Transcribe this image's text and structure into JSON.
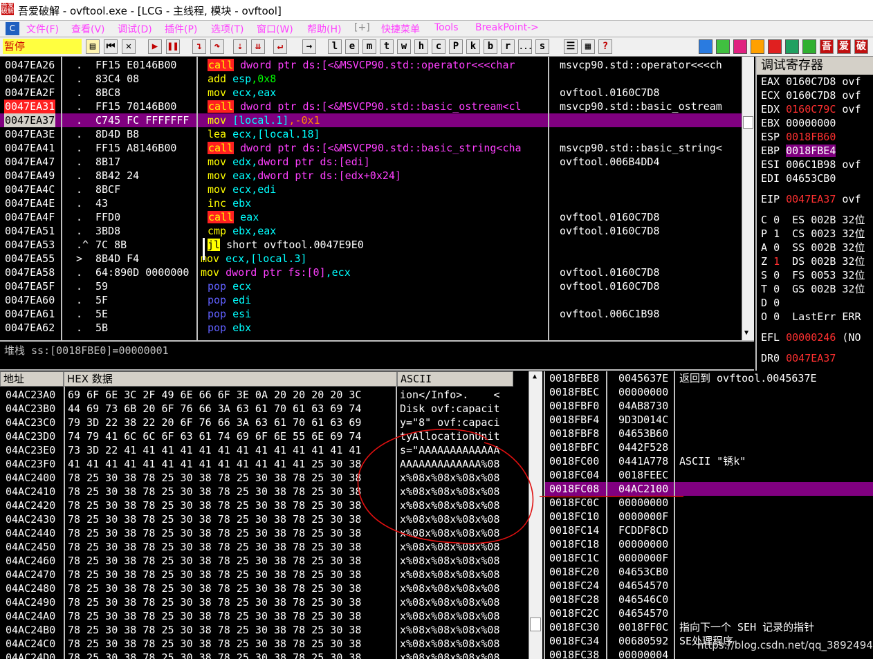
{
  "window": {
    "title": "吾爱破解 - ovftool.exe - [LCG - 主线程, 模块 - ovftool]"
  },
  "menu": [
    "文件(F)",
    "查看(V)",
    "调试(D)",
    "插件(P)",
    "选项(T)",
    "窗口(W)",
    "帮助(H)",
    "[+]",
    "快捷菜单",
    "Tools",
    "BreakPoint->"
  ],
  "toolbar": {
    "status": "暂停",
    "letters": [
      "l",
      "e",
      "m",
      "t",
      "w",
      "h",
      "c",
      "P",
      "k",
      "b",
      "r",
      "...",
      "s"
    ],
    "right_icons": [
      "吾",
      "爱",
      "破"
    ]
  },
  "disasm": {
    "rows": [
      {
        "addr": "0047EA26",
        "mark": ".",
        "hex": "FF15 E0146B00",
        "instr": [
          [
            "call",
            "callbox"
          ],
          [
            " dword ptr ds:[<&MSVCP90.std::operator<<<char",
            "m"
          ]
        ],
        "cmt": "msvcp90.std::operator<<<ch"
      },
      {
        "addr": "0047EA2C",
        "mark": ".",
        "hex": "83C4 08",
        "instr": [
          [
            "add ",
            "y"
          ],
          [
            "esp",
            "c"
          ],
          [
            ",0x8",
            "g"
          ]
        ],
        "cmt": ""
      },
      {
        "addr": "0047EA2F",
        "mark": ".",
        "hex": "8BC8",
        "instr": [
          [
            "mov ",
            "y"
          ],
          [
            "ecx,eax",
            "c"
          ]
        ],
        "cmt": "ovftool.0160C7D8"
      },
      {
        "addr": "0047EA31",
        "mark": ".",
        "hex": "FF15 70146B00",
        "instr": [
          [
            "call",
            "callbox"
          ],
          [
            " dword ptr ds:[<&MSVCP90.std::basic_ostream<cl",
            "m"
          ]
        ],
        "cmt": "msvcp90.std::basic_ostream",
        "addrHi": "red"
      },
      {
        "addr": "0047EA37",
        "mark": ".",
        "hex": "C745 FC FFFFFFF",
        "instr": [
          [
            "mov ",
            "y"
          ],
          [
            "[local.1]",
            "c"
          ],
          [
            ",-0x1",
            "o"
          ]
        ],
        "cmt": "",
        "sel": true
      },
      {
        "addr": "0047EA3E",
        "mark": ".",
        "hex": "8D4D B8",
        "instr": [
          [
            "lea ",
            "y"
          ],
          [
            "ecx,[local.18]",
            "c"
          ]
        ],
        "cmt": ""
      },
      {
        "addr": "0047EA41",
        "mark": ".",
        "hex": "FF15 A8146B00",
        "instr": [
          [
            "call",
            "callbox"
          ],
          [
            " dword ptr ds:[<&MSVCP90.std::basic_string<cha",
            "m"
          ]
        ],
        "cmt": "msvcp90.std::basic_string<"
      },
      {
        "addr": "0047EA47",
        "mark": ".",
        "hex": "8B17",
        "instr": [
          [
            "mov ",
            "y"
          ],
          [
            "edx,",
            "c"
          ],
          [
            "dword ptr ds:[edi]",
            "m"
          ]
        ],
        "cmt": "ovftool.006B4DD4"
      },
      {
        "addr": "0047EA49",
        "mark": ".",
        "hex": "8B42 24",
        "instr": [
          [
            "mov ",
            "y"
          ],
          [
            "eax,",
            "c"
          ],
          [
            "dword ptr ds:[edx+0x24]",
            "m"
          ]
        ],
        "cmt": ""
      },
      {
        "addr": "0047EA4C",
        "mark": ".",
        "hex": "8BCF",
        "instr": [
          [
            "mov ",
            "y"
          ],
          [
            "ecx,edi",
            "c"
          ]
        ],
        "cmt": ""
      },
      {
        "addr": "0047EA4E",
        "mark": ".",
        "hex": "43",
        "instr": [
          [
            "inc ",
            "y"
          ],
          [
            "ebx",
            "c"
          ]
        ],
        "cmt": ""
      },
      {
        "addr": "0047EA4F",
        "mark": ".",
        "hex": "FFD0",
        "instr": [
          [
            "call",
            "callbox"
          ],
          [
            " eax",
            "c"
          ]
        ],
        "cmt": "ovftool.0160C7D8"
      },
      {
        "addr": "0047EA51",
        "mark": ".",
        "hex": "3BD8",
        "instr": [
          [
            "cmp ",
            "y"
          ],
          [
            "ebx,eax",
            "c"
          ]
        ],
        "cmt": "ovftool.0160C7D8"
      },
      {
        "addr": "0047EA53",
        "mark": ".^",
        "hex": "7C 8B",
        "instr": [
          [
            "jl",
            "jl"
          ],
          [
            " short ovftool.0047E9E0",
            "w"
          ]
        ],
        "cmt": ""
      },
      {
        "addr": "0047EA55",
        "mark": ">",
        "hex": "8B4D F4",
        "instr": [
          [
            "mov ",
            "y"
          ],
          [
            "ecx,[local.3]",
            "c"
          ]
        ],
        "cmt": "",
        "noBar": true
      },
      {
        "addr": "0047EA58",
        "mark": ".",
        "hex": "64:890D 0000000",
        "instr": [
          [
            "mov ",
            "y"
          ],
          [
            "dword ptr fs:[0]",
            "m"
          ],
          [
            ",ecx",
            "c"
          ]
        ],
        "cmt": "ovftool.0160C7D8",
        "noBar": true
      },
      {
        "addr": "0047EA5F",
        "mark": ".",
        "hex": "59",
        "instr": [
          [
            "pop ",
            "bl"
          ],
          [
            "ecx",
            "c"
          ]
        ],
        "cmt": "ovftool.0160C7D8"
      },
      {
        "addr": "0047EA60",
        "mark": ".",
        "hex": "5F",
        "instr": [
          [
            "pop ",
            "bl"
          ],
          [
            "edi",
            "c"
          ]
        ],
        "cmt": ""
      },
      {
        "addr": "0047EA61",
        "mark": ".",
        "hex": "5E",
        "instr": [
          [
            "pop ",
            "bl"
          ],
          [
            "esi",
            "c"
          ]
        ],
        "cmt": "ovftool.006C1B98"
      },
      {
        "addr": "0047EA62",
        "mark": ".",
        "hex": "5B",
        "instr": [
          [
            "pop ",
            "bl"
          ],
          [
            "ebx",
            "c"
          ]
        ],
        "cmt": ""
      }
    ],
    "info_line": "堆栈 ss:[0018FBE0]=00000001"
  },
  "registers": {
    "header": "调试寄存器",
    "gp": [
      {
        "name": "EAX",
        "val": "0160C7D8",
        "cmt": "ovf"
      },
      {
        "name": "ECX",
        "val": "0160C7D8",
        "cmt": "ovf"
      },
      {
        "name": "EDX",
        "val": "0160C79C",
        "cmt": "ovf",
        "red": true
      },
      {
        "name": "EBX",
        "val": "00000000",
        "cmt": ""
      },
      {
        "name": "ESP",
        "val": "0018FB60",
        "cmt": "",
        "red": true
      },
      {
        "name": "EBP",
        "val": "0018FBE4",
        "cmt": "",
        "hi": true
      },
      {
        "name": "ESI",
        "val": "006C1B98",
        "cmt": "ovf"
      },
      {
        "name": "EDI",
        "val": "04653CB0",
        "cmt": ""
      }
    ],
    "eip": {
      "name": "EIP",
      "val": "0047EA37",
      "cmt": "ovf"
    },
    "flags": [
      {
        "f": "C",
        "v": "0",
        "seg": "ES",
        "sv": "002B",
        "bits": "32位"
      },
      {
        "f": "P",
        "v": "1",
        "seg": "CS",
        "sv": "0023",
        "bits": "32位"
      },
      {
        "f": "A",
        "v": "0",
        "seg": "SS",
        "sv": "002B",
        "bits": "32位"
      },
      {
        "f": "Z",
        "v": "1",
        "seg": "DS",
        "sv": "002B",
        "bits": "32位",
        "red": true
      },
      {
        "f": "S",
        "v": "0",
        "seg": "FS",
        "sv": "0053",
        "bits": "32位"
      },
      {
        "f": "T",
        "v": "0",
        "seg": "GS",
        "sv": "002B",
        "bits": "32位"
      },
      {
        "f": "D",
        "v": "0",
        "seg": "",
        "sv": "",
        "bits": ""
      },
      {
        "f": "O",
        "v": "0",
        "seg": "LastErr",
        "sv": "ERR",
        "bits": ""
      }
    ],
    "efl": {
      "name": "EFL",
      "val": "00000246",
      "cmt": "(NO"
    },
    "dr0": {
      "name": "DR0",
      "val": "0047EA37"
    }
  },
  "dump": {
    "headers": {
      "addr": "地址",
      "hex": "HEX 数据",
      "ascii": "ASCII"
    },
    "rows": [
      {
        "addr": "04AC23A0",
        "hex": "69 6F 6E 3C|2F 49 6E 66|6F 3E 0A 20|20 20 20 3C",
        "ascii": "ion</Info>.    <"
      },
      {
        "addr": "04AC23B0",
        "hex": "44 69 73 6B|20 6F 76 66|3A 63 61 70|61 63 69 74",
        "ascii": "Disk ovf:capacit"
      },
      {
        "addr": "04AC23C0",
        "hex": "79 3D 22 38|22 20 6F 76|66 3A 63 61|70 61 63 69",
        "ascii": "y=\"8\" ovf:capaci"
      },
      {
        "addr": "04AC23D0",
        "hex": "74 79 41 6C|6C 6F 63 61|74 69 6F 6E|55 6E 69 74",
        "ascii": "tyAllocationUnit"
      },
      {
        "addr": "04AC23E0",
        "hex": "73 3D 22 41|41 41 41 41|41 41 41 41|41 41 41 41",
        "ascii": "s=\"AAAAAAAAAAAAA"
      },
      {
        "addr": "04AC23F0",
        "hex": "41 41 41 41|41 41 41 41|41 41 41 41|41 25 30 38",
        "ascii": "AAAAAAAAAAAAA%08"
      },
      {
        "addr": "04AC2400",
        "hex": "78 25 30 38|78 25 30 38|78 25 30 38|78 25 30 38",
        "ascii": "x%08x%08x%08x%08"
      },
      {
        "addr": "04AC2410",
        "hex": "78 25 30 38|78 25 30 38|78 25 30 38|78 25 30 38",
        "ascii": "x%08x%08x%08x%08"
      },
      {
        "addr": "04AC2420",
        "hex": "78 25 30 38|78 25 30 38|78 25 30 38|78 25 30 38",
        "ascii": "x%08x%08x%08x%08"
      },
      {
        "addr": "04AC2430",
        "hex": "78 25 30 38|78 25 30 38|78 25 30 38|78 25 30 38",
        "ascii": "x%08x%08x%08x%08"
      },
      {
        "addr": "04AC2440",
        "hex": "78 25 30 38|78 25 30 38|78 25 30 38|78 25 30 38",
        "ascii": "x%08x%08x%08x%08"
      },
      {
        "addr": "04AC2450",
        "hex": "78 25 30 38|78 25 30 38|78 25 30 38|78 25 30 38",
        "ascii": "x%08x%08x%08x%08"
      },
      {
        "addr": "04AC2460",
        "hex": "78 25 30 38|78 25 30 38|78 25 30 38|78 25 30 38",
        "ascii": "x%08x%08x%08x%08"
      },
      {
        "addr": "04AC2470",
        "hex": "78 25 30 38|78 25 30 38|78 25 30 38|78 25 30 38",
        "ascii": "x%08x%08x%08x%08"
      },
      {
        "addr": "04AC2480",
        "hex": "78 25 30 38|78 25 30 38|78 25 30 38|78 25 30 38",
        "ascii": "x%08x%08x%08x%08"
      },
      {
        "addr": "04AC2490",
        "hex": "78 25 30 38|78 25 30 38|78 25 30 38|78 25 30 38",
        "ascii": "x%08x%08x%08x%08"
      },
      {
        "addr": "04AC24A0",
        "hex": "78 25 30 38|78 25 30 38|78 25 30 38|78 25 30 38",
        "ascii": "x%08x%08x%08x%08"
      },
      {
        "addr": "04AC24B0",
        "hex": "78 25 30 38|78 25 30 38|78 25 30 38|78 25 30 38",
        "ascii": "x%08x%08x%08x%08"
      },
      {
        "addr": "04AC24C0",
        "hex": "78 25 30 38|78 25 30 38|78 25 30 38|78 25 30 38",
        "ascii": "x%08x%08x%08x%08"
      },
      {
        "addr": "04AC24D0",
        "hex": "78 25 30 38|78 25 30 38|78 25 30 38|78 25 30 38",
        "ascii": "x%08x%08x%08x%08"
      }
    ]
  },
  "stack": {
    "rows": [
      {
        "addr": "0018FBE8",
        "val": "0045637E",
        "cmt": "返回到 ovftool.0045637E"
      },
      {
        "addr": "0018FBEC",
        "val": "00000000",
        "cmt": ""
      },
      {
        "addr": "0018FBF0",
        "val": "04AB8730",
        "cmt": ""
      },
      {
        "addr": "0018FBF4",
        "val": "9D3D014C",
        "cmt": ""
      },
      {
        "addr": "0018FBF8",
        "val": "04653B60",
        "cmt": ""
      },
      {
        "addr": "0018FBFC",
        "val": "0442F528",
        "cmt": ""
      },
      {
        "addr": "0018FC00",
        "val": "0441A778",
        "cmt": "ASCII \"锈k\""
      },
      {
        "addr": "0018FC04",
        "val": "0018FEEC",
        "cmt": ""
      },
      {
        "addr": "0018FC08",
        "val": "04AC2100",
        "cmt": "",
        "sel": true
      },
      {
        "addr": "0018FC0C",
        "val": "00000000",
        "cmt": ""
      },
      {
        "addr": "0018FC10",
        "val": "0000000F",
        "cmt": ""
      },
      {
        "addr": "0018FC14",
        "val": "FCDDF8CD",
        "cmt": ""
      },
      {
        "addr": "0018FC18",
        "val": "00000000",
        "cmt": ""
      },
      {
        "addr": "0018FC1C",
        "val": "0000000F",
        "cmt": ""
      },
      {
        "addr": "0018FC20",
        "val": "04653CB0",
        "cmt": ""
      },
      {
        "addr": "0018FC24",
        "val": "04654570",
        "cmt": ""
      },
      {
        "addr": "0018FC28",
        "val": "046546C0",
        "cmt": ""
      },
      {
        "addr": "0018FC2C",
        "val": "04654570",
        "cmt": ""
      },
      {
        "addr": "0018FC30",
        "val": "0018FF0C",
        "cmt": "指向下一个 SEH 记录的指针"
      },
      {
        "addr": "0018FC34",
        "val": "00680592",
        "cmt": "SE处理程序"
      },
      {
        "addr": "0018FC38",
        "val": "00000004",
        "cmt": ""
      }
    ]
  },
  "watermark": "https://blog.csdn.net/qq_38924942",
  "colors": {
    "bg": "#000000",
    "selection": "#800080",
    "call_bg": "#ff2020",
    "status_bg": "#ffff40"
  }
}
